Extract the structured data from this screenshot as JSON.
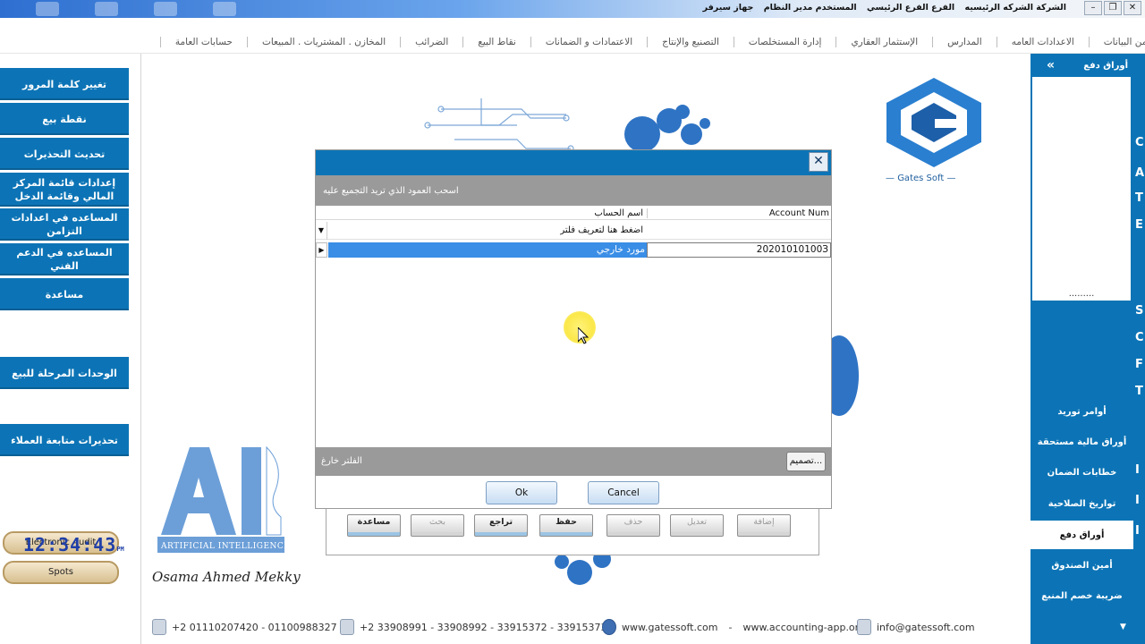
{
  "titlebar": {
    "company": "الشركة الشركه الرئيسيه",
    "branch": "الفرع الفرع الرئيسي",
    "user": "المستخدم مدير النظام",
    "device": "جهاز سيرفر",
    "minimize": "–",
    "restore": "❐",
    "close": "✕"
  },
  "menu": {
    "items": [
      "حسابات العامة",
      "المخازن . المشتريات . المبيعات",
      "الضرائب",
      "نقاط البيع",
      "الاعتمادات و الضمانات",
      "التصنيع والإنتاج",
      "إدارة المستخلصات",
      "الإستثمار العقاري",
      "المدارس",
      "الاعدادات العامه",
      "تزامن البيانات"
    ]
  },
  "left_panel": {
    "buttons": [
      "تغيير كلمة المرور",
      "نقطة بيع",
      "تحديث التحذيرات",
      "إعدادات قائمة المركز المالي وقائمة الدخل",
      "المساعده في اعدادات التزامن",
      "المساعده في الدعم الفني",
      "مساعدة",
      "الوحدات المرحلة للبيع",
      "تحذيرات متابعة العملاء"
    ],
    "electronic_audit": "Electronic Audit",
    "spots": "Spots",
    "clock_time": "12:34:43",
    "clock_ampm": "PM"
  },
  "right_panel": {
    "header": "أوراق دفع",
    "expand_icon": "»",
    "dots": ".........",
    "items": [
      "أوامر توريد",
      "أوراق مالية مستحقة",
      "خطابات الضمان",
      "تواريخ الصلاحية",
      "أوراق دفع",
      "أمين الصندوق",
      "ضريبة خصم المنبع"
    ],
    "active_item": "أوراق دفع",
    "edge_letters": [
      "C",
      "A",
      "T",
      "E",
      "S",
      "C",
      "F",
      "T",
      "I",
      "I",
      "I"
    ],
    "scroll_down": "▼"
  },
  "dialog": {
    "close": "✕",
    "group_hint": "اسحب العمود الذي تريد التجميع عليه",
    "columns": {
      "name": "اسم الحساب",
      "account_num": "Account Num"
    },
    "filter_row_text": "اضغط هنا لتعريف فلتر",
    "filter_icon": "▼",
    "rows": [
      {
        "name": "مورد خارجي",
        "account_num": "20201010100З"
      }
    ],
    "row_marker": "▶",
    "filter_bar_label": "الفلتر خارغ",
    "customize": "...تصميم",
    "ok": "Ok",
    "cancel": "Cancel"
  },
  "toolbar": {
    "help": "مساعدة",
    "search": "بحث",
    "undo": "تراجع",
    "save": "حفظ",
    "delete": "حذف",
    "edit": "تعديل",
    "add": "إضافة"
  },
  "footer": {
    "mobile": "+2 01110207420 - 01100988327",
    "phone": "+2 33908991 - 33908992 - 33915372 - 33915373",
    "site1": "www.gatessoft.com",
    "sep": "-",
    "site2": "www.accounting-app.org",
    "email": "info@gatessoft.com"
  },
  "branding": {
    "gates_soft": "Gates Soft",
    "ai_label": "ARTIFICIAL INTELLIGENCE",
    "signature": "Osama Ahmed Mekky"
  },
  "colors": {
    "primary_blue": "#0c74b6",
    "selection_blue": "#3a8ee6",
    "gray_bar": "#9a9a9a"
  }
}
